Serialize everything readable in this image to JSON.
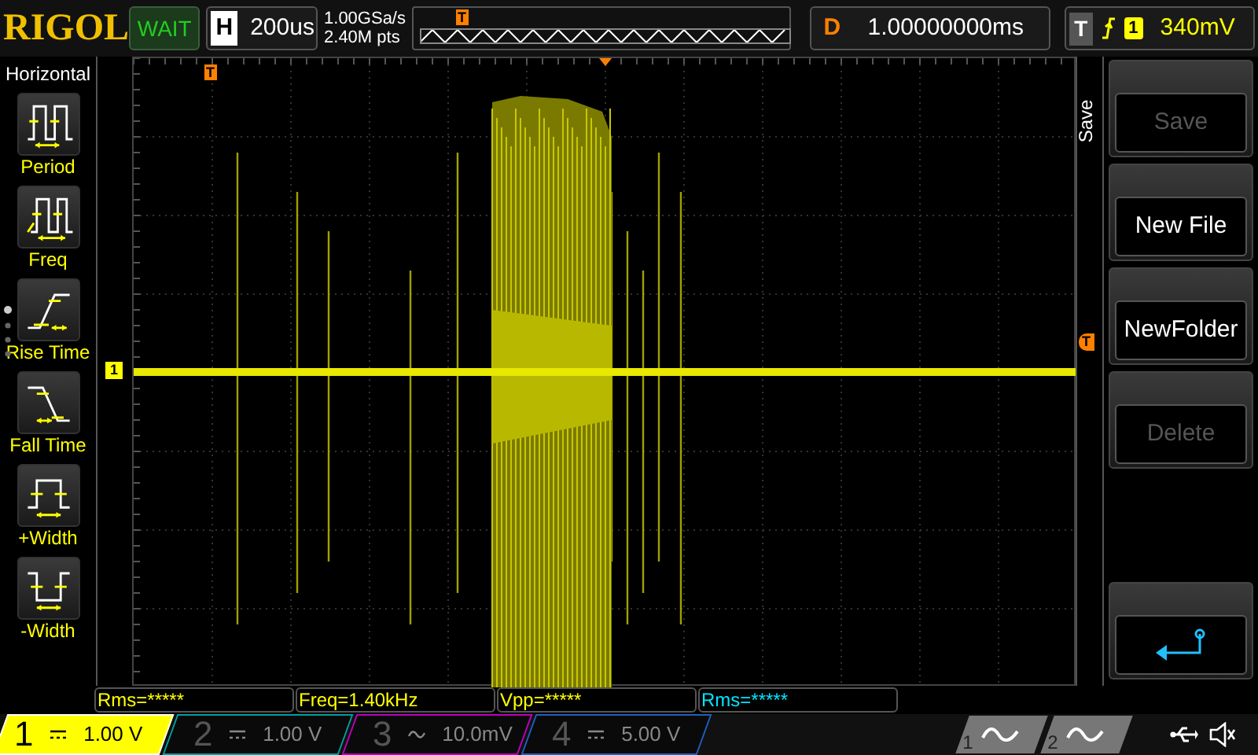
{
  "brand": "RIGOL",
  "run_status": "WAIT",
  "timebase": {
    "label": "H",
    "value": "200us"
  },
  "acquisition": {
    "sample_rate": "1.00GSa/s",
    "memory_depth": "2.40M pts"
  },
  "trigger_position_marker": "T",
  "delay": {
    "label": "D",
    "value": "1.00000000ms"
  },
  "trigger": {
    "label": "T",
    "source": "1",
    "level": "340mV"
  },
  "left_menu": {
    "title": "Horizontal",
    "items": [
      {
        "kind": "period",
        "label": "Period"
      },
      {
        "kind": "freq",
        "label": "Freq"
      },
      {
        "kind": "rise",
        "label": "Rise Time"
      },
      {
        "kind": "fall",
        "label": "Fall Time"
      },
      {
        "kind": "pwidth",
        "label": "+Width"
      },
      {
        "kind": "nwidth",
        "label": "-Width"
      }
    ]
  },
  "scope": {
    "channel_marker": "1",
    "trigger_level_marker": "T",
    "top_marker": "T"
  },
  "right_menu": {
    "title": "Save",
    "buttons": [
      {
        "label": "Save",
        "disabled": true
      },
      {
        "label": "New File",
        "disabled": false
      },
      {
        "label": "NewFolder",
        "disabled": false
      },
      {
        "label": "Delete",
        "disabled": true
      }
    ]
  },
  "measurements": [
    {
      "text": "Rms=*****",
      "color": "#ffff00"
    },
    {
      "text": "Freq=1.40kHz",
      "color": "#ffff00"
    },
    {
      "text": "Vpp=*****",
      "color": "#ffff00"
    },
    {
      "text": "Rms=*****",
      "color": "#00e5ff"
    }
  ],
  "channels": [
    {
      "number": "1",
      "kind": "dc",
      "scale": "1.00 V",
      "active": true,
      "color": "#ffff00"
    },
    {
      "number": "2",
      "kind": "dc",
      "scale": "1.00 V",
      "active": false,
      "color": "#00a0a0"
    },
    {
      "number": "3",
      "kind": "ac",
      "scale": "10.0mV",
      "active": false,
      "color": "#c000c0"
    },
    {
      "number": "4",
      "kind": "dc",
      "scale": "5.00 V",
      "active": false,
      "color": "#2060c0"
    }
  ],
  "generators": [
    {
      "number": "1"
    },
    {
      "number": "2"
    }
  ]
}
